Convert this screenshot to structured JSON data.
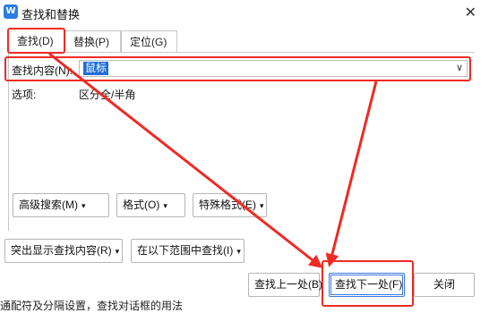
{
  "window": {
    "title": "查找和替换",
    "app_icon_letter": "W",
    "close_glyph": "✕"
  },
  "tabs": [
    {
      "label": "查找(D)",
      "active": true
    },
    {
      "label": "替换(P)",
      "active": false
    },
    {
      "label": "定位(G)",
      "active": false
    }
  ],
  "find": {
    "label": "查找内容(N):",
    "value": "鼠标",
    "dropdown_glyph": "∨"
  },
  "options": {
    "label": "选项:",
    "value": "区分全/半角"
  },
  "buttons": {
    "advanced": "高级搜索(M)",
    "advanced_arrow": "▾",
    "format": "格式(O)",
    "format_arrow": "▾",
    "special": "特殊格式(E)",
    "special_arrow": "▾",
    "highlight": "突出显示查找内容(R)",
    "highlight_arrow": "▾",
    "range": "在以下范围中查找(I)",
    "range_arrow": "▾",
    "prev": "查找上一处(B)",
    "next": "查找下一处(F)",
    "close": "关闭"
  },
  "footer_text": "通配符及分隔设置，查找对话框的用法",
  "colors": {
    "annotation_red": "#ee2b24",
    "selection_blue": "#1f6fd6",
    "default_button_border": "#3c78d8",
    "app_icon_blue": "#2a7de1"
  }
}
